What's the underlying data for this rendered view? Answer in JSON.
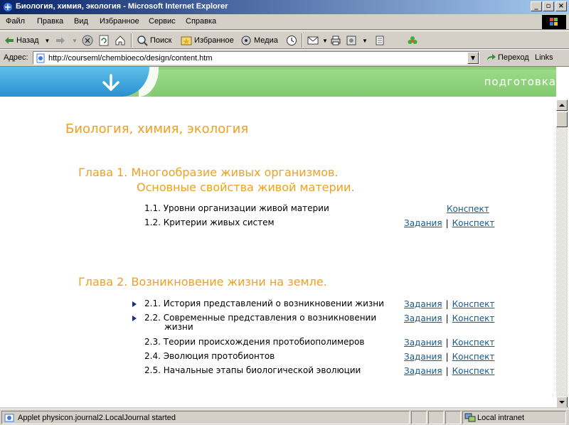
{
  "window": {
    "title": "Биология, химия, экология - Microsoft Internet Explorer"
  },
  "menu": [
    "Файл",
    "Правка",
    "Вид",
    "Избранное",
    "Сервис",
    "Справка"
  ],
  "toolbar": {
    "back_label": "Назад",
    "search_label": "Поиск",
    "favorites_label": "Избранное",
    "media_label": "Медиа"
  },
  "address": {
    "label": "Адрес:",
    "url": "http://courseml/chembioeco/design/content.htm",
    "go_label": "Переход",
    "links_label": "Links"
  },
  "banner": {
    "label": "подготовка"
  },
  "page": {
    "title": "Биология, химия, экология",
    "chapters": [
      {
        "title_line1": "Глава 1. Многообразие живых организмов.",
        "title_line2": "Основные свойства живой материи.",
        "items": [
          {
            "number": "1.1.",
            "text": "Уровни организации живой материи",
            "links": [
              "Конспект"
            ]
          },
          {
            "number": "1.2.",
            "text": "Критерии живых систем",
            "links": [
              "Задания",
              "Конспект"
            ]
          }
        ]
      },
      {
        "title_line1": "Глава 2. Возникновение жизни на земле.",
        "title_line2": "",
        "items": [
          {
            "number": "2.1.",
            "text": "История представлений о возникновении жизни",
            "links": [
              "Задания",
              "Конспект"
            ],
            "bullet": true
          },
          {
            "number": "2.2.",
            "text": "Современные представления о возникновении",
            "text2": "жизни",
            "links": [
              "Задания",
              "Конспект"
            ],
            "bullet": true
          },
          {
            "number": "2.3.",
            "text": "Теории происхождения протобиополимеров",
            "links": [
              "Задания",
              "Конспект"
            ]
          },
          {
            "number": "2.4.",
            "text": "Эволюция протобионтов",
            "links": [
              "Задания",
              "Конспект"
            ]
          },
          {
            "number": "2.5.",
            "text": "Начальные этапы биологической эволюции",
            "links": [
              "Задания",
              "Конспект"
            ]
          }
        ]
      }
    ],
    "link_separator": "|"
  },
  "status": {
    "text": "Applet physicon.journal2.LocalJournal started",
    "zone": "Local intranet"
  },
  "colors": {
    "title_bar": "#0a246a",
    "chapter_orange": "#f0a020",
    "banner_green": "#8fd07d",
    "banner_blue": "#2a8fcf",
    "link": "#1a5a8a"
  }
}
